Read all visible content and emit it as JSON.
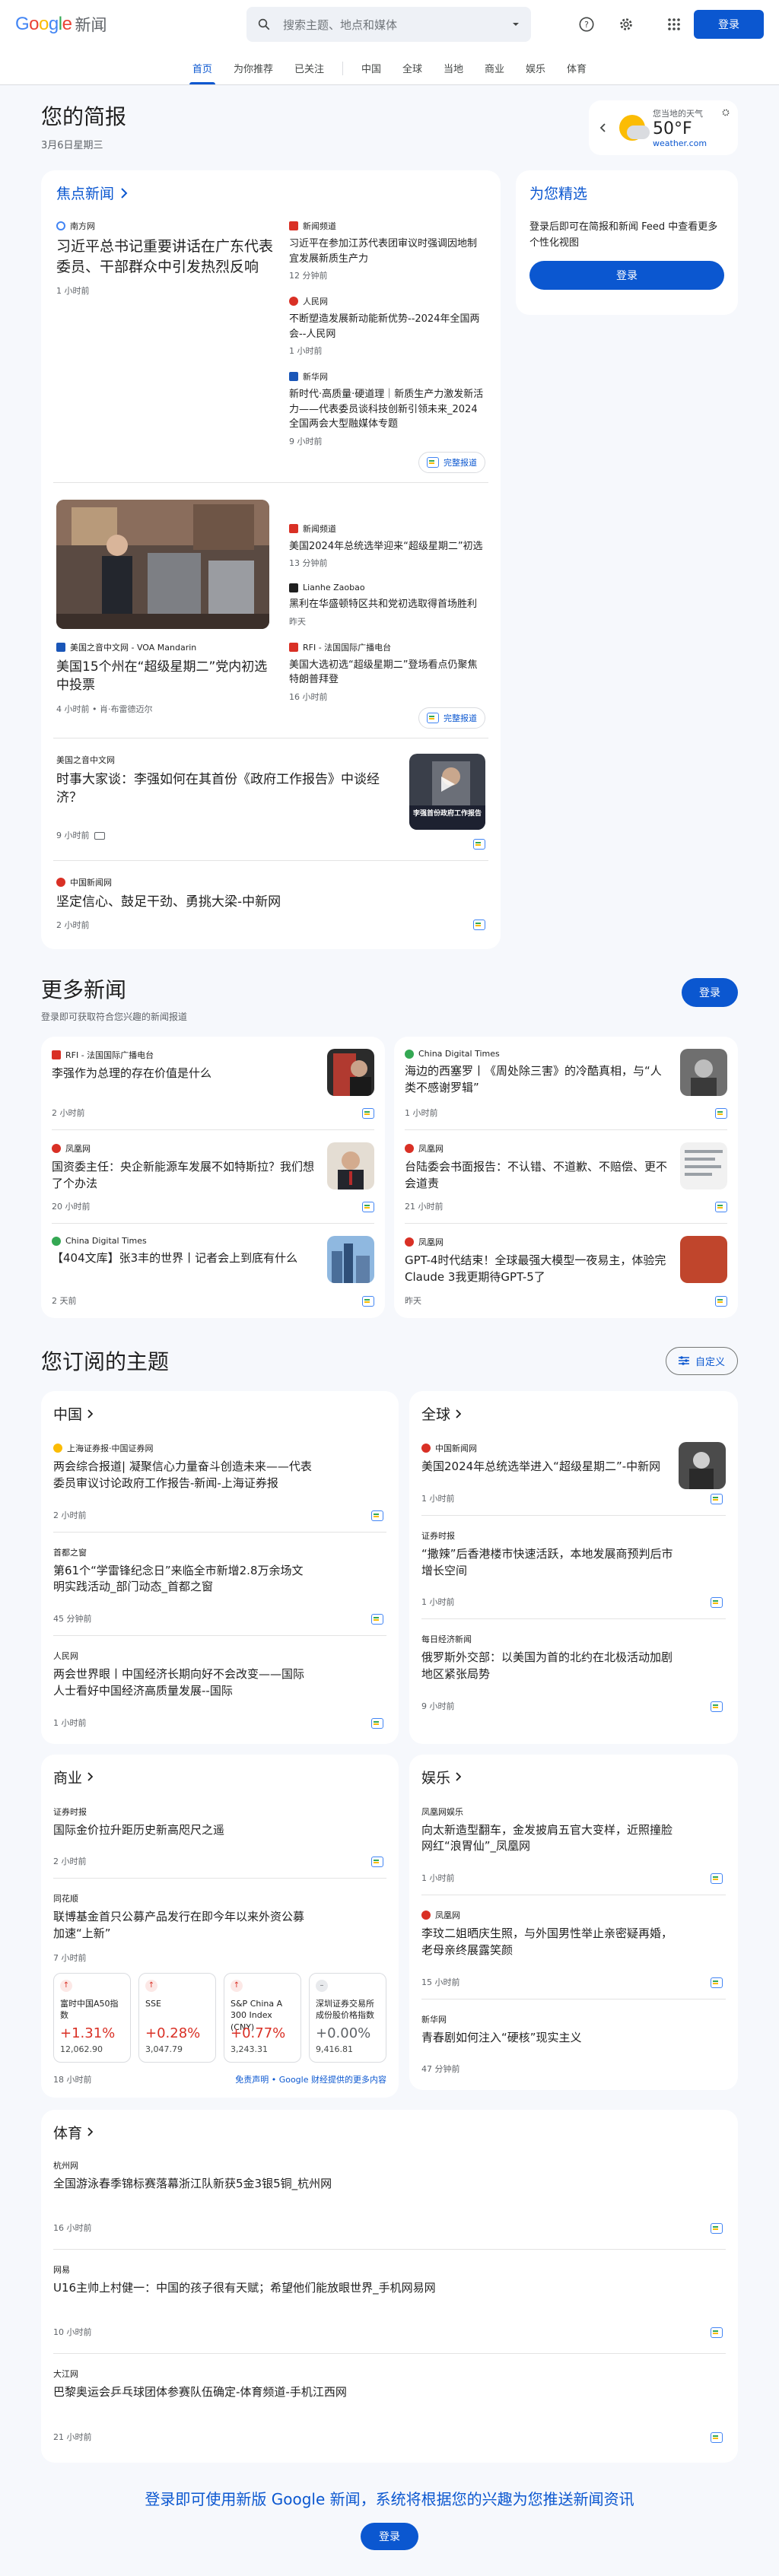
{
  "header": {
    "logo_google": "Google",
    "logo_news": "新闻",
    "search_placeholder": "搜索主题、地点和媒体",
    "signin": "登录"
  },
  "nav": {
    "tabs": [
      "首页",
      "为你推荐",
      "已关注",
      "中国",
      "全球",
      "当地",
      "商业",
      "娱乐",
      "体育"
    ]
  },
  "brief": {
    "title": "您的简报",
    "date": "3月6日星期三"
  },
  "weather": {
    "location": "您当地的天气",
    "temp": "50°F",
    "source": "weather.com"
  },
  "focus": {
    "heading": "焦点新闻",
    "clusters": [
      {
        "source": "南方网",
        "title": "习近平总书记重要讲话在广东代表委员、干部群众中引发热烈反响",
        "time": "1 小时前",
        "subs": [
          {
            "source": "新闻频道",
            "title": "习近平在参加江苏代表团审议时强调因地制宜发展新质生产力",
            "time": "12 分钟前"
          },
          {
            "source": "人民网",
            "title": "不断塑造发展新动能新优势--2024年全国两会--人民网",
            "time": "1 小时前"
          },
          {
            "source": "新华网",
            "title": "新时代·高质量·硬道理｜新质生产力激发新活力——代表委员谈科技创新引领未来_2024全国两会大型融媒体专题",
            "time": "9 小时前"
          }
        ],
        "full": "完整报道"
      },
      {
        "source": "美国之音中文网 - VOA Mandarin",
        "title": "美国15个州在“超级星期二”党内初选中投票",
        "time": "4 小时前 • 肖·布雷德迈尔",
        "subs": [
          {
            "source": "新闻频道",
            "title": "美国2024年总统选举迎来“超级星期二”初选",
            "time": "13 分钟前"
          },
          {
            "source": "Lianhe Zaobao",
            "title": "黑利在华盛顿特区共和党初选取得首场胜利",
            "time": "昨天"
          },
          {
            "source": "RFI - 法国国际广播电台",
            "title": "美国大选初选“超级星期二”登场看点仍聚焦特朗普拜登",
            "time": "16 小时前"
          }
        ],
        "full": "完整报道"
      }
    ],
    "singles": [
      {
        "source": "美国之音中文网",
        "title": "时事大家谈：李强如何在其首份《政府工作报告》中谈经济？",
        "time": "9 小时前",
        "thumb_caption": "李强首份政府工作报告"
      },
      {
        "source": "中国新闻网",
        "title": "坚定信心、鼓足干劲、勇挑大梁-中新网",
        "time": "2 小时前"
      }
    ]
  },
  "picks": {
    "title": "为您精选",
    "text": "登录后即可在简报和新闻 Feed 中查看更多个性化视图",
    "button": "登录"
  },
  "more": {
    "title": "更多新闻",
    "subtitle": "登录即可获取符合您兴趣的新闻报道",
    "button": "登录",
    "left": [
      {
        "source": "RFI - 法国国际广播电台",
        "title": "李强作为总理的存在价值是什么",
        "time": "2 小时前"
      },
      {
        "source": "凤凰网",
        "title": "国资委主任：央企新能源车发展不如特斯拉？我们想了个办法",
        "time": "20 小时前"
      },
      {
        "source": "China Digital Times",
        "title": "【404文库】张3丰的世界丨记者会上到底有什么",
        "time": "2 天前"
      }
    ],
    "right": [
      {
        "source": "China Digital Times",
        "title": "海边的西塞罗丨《周处除三害》的冷酷真相，与“人类不感谢罗辑”",
        "time": "1 小时前"
      },
      {
        "source": "凤凰网",
        "title": "台陆委会书面报告：不认错、不道歉、不赔偿、更不会道责",
        "time": "21 小时前"
      },
      {
        "source": "凤凰网",
        "title": "GPT-4时代结束！全球最强大模型一夜易主，体验完Claude 3我更期待GPT-5了",
        "time": "昨天"
      }
    ]
  },
  "subscribed": {
    "title": "您订阅的主题",
    "customize": "自定义"
  },
  "topics": {
    "china": {
      "title": "中国",
      "items": [
        {
          "source": "上海证券报·中国证券网",
          "title": "两会综合报道| 凝聚信心力量奋斗创造未来——代表委员审议讨论政府工作报告-新闻-上海证券报",
          "time": "2 小时前"
        },
        {
          "source": "首都之窗",
          "title": "第61个“学雷锋纪念日”来临全市新增2.8万余场文明实践活动_部门动态_首都之窗",
          "time": "45 分钟前"
        },
        {
          "source": "人民网",
          "title": "两会世界眼丨中国经济长期向好不会改变——国际人士看好中国经济高质量发展--国际",
          "time": "1 小时前"
        }
      ]
    },
    "world": {
      "title": "全球",
      "items": [
        {
          "source": "中国新闻网",
          "title": "美国2024年总统选举进入“超级星期二”-中新网",
          "time": "1 小时前"
        },
        {
          "source": "证券时报",
          "title": "“撒辣”后香港楼市快速活跃，本地发展商预判后市增长空间",
          "time": "1 小时前"
        },
        {
          "source": "每日经济新闻",
          "title": "俄罗斯外交部：以美国为首的北约在北极活动加剧地区紧张局势",
          "time": "9 小时前"
        }
      ]
    },
    "business": {
      "title": "商业",
      "items": [
        {
          "source": "证券时报",
          "title": "国际金价拉升距历史新高咫尺之遥",
          "time": "2 小时前"
        },
        {
          "source": "同花顺",
          "title": "联博基金首只公募产品发行在即今年以来外资公募加速“上新”",
          "time": "7 小时前"
        }
      ],
      "stocks": [
        {
          "name": "富时中国A50指数",
          "change": "+1.31%",
          "value": "12,062.90",
          "dir": "up",
          "color": "#d93025"
        },
        {
          "name": "SSE",
          "change": "+0.28%",
          "value": "3,047.79",
          "dir": "up",
          "color": "#d93025"
        },
        {
          "name": "S&P China A 300 Index (CNY)",
          "change": "+0.77%",
          "value": "3,243.31",
          "dir": "up",
          "color": "#d93025"
        },
        {
          "name": "深圳证券交易所成份股价格指数",
          "change": "+0.00%",
          "value": "9,416.81",
          "dir": "flat",
          "color": "#5f6368"
        }
      ],
      "stock_time": "18 小时前",
      "disclaimer": "免责声明 • Google 财经提供的更多内容"
    },
    "entertainment": {
      "title": "娱乐",
      "items": [
        {
          "source": "凤凰网娱乐",
          "title": "向太新造型翻车，金发披肩五官大变样，近照撞脸网红“浪胃仙”_凤凰网",
          "time": "1 小时前"
        },
        {
          "source": "凤凰网",
          "title": "李玟二姐晒庆生照，与外国男性举止亲密疑再婚，老母亲终展露笑颜",
          "time": "15 小时前"
        },
        {
          "source": "新华网",
          "title": "青春剧如何注入“硬核”现实主义",
          "time": "47 分钟前"
        }
      ]
    },
    "sports": {
      "title": "体育",
      "items": [
        {
          "source": "杭州网",
          "title": "全国游泳春季锦标赛落幕浙江队新获5金3银5铜_杭州网",
          "time": "16 小时前"
        },
        {
          "source": "网易",
          "title": "U16主帅上村健一：中国的孩子很有天赋；希望他们能放眼世界_手机网易网",
          "time": "10 小时前"
        },
        {
          "source": "大江网",
          "title": "巴黎奥运会乒乓球团体参赛队伍确定-体育频道-手机江西网",
          "time": "21 小时前"
        }
      ]
    }
  },
  "footer": {
    "message": "登录即可使用新版 Google 新闻，系统将根据您的兴趣为您推送新闻资讯",
    "button": "登录"
  }
}
